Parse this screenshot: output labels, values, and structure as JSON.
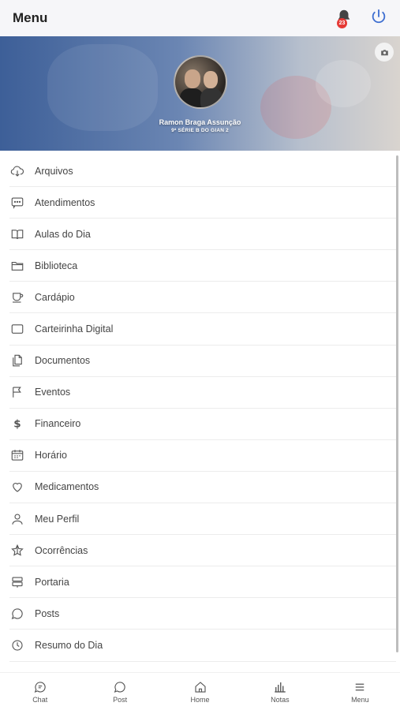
{
  "header": {
    "title": "Menu",
    "notification_count": "23",
    "bell_icon": "bell-icon",
    "power_icon": "power-icon"
  },
  "profile": {
    "name": "Ramon Braga Assunção",
    "class": "9ª SÉRIE B DO GIAN 2",
    "camera_icon": "camera-icon"
  },
  "menu": {
    "items": [
      {
        "label": "Arquivos",
        "icon": "cloud-download-icon"
      },
      {
        "label": "Atendimentos",
        "icon": "chat-box-icon"
      },
      {
        "label": "Aulas do Dia",
        "icon": "book-open-icon"
      },
      {
        "label": "Biblioteca",
        "icon": "folder-icon"
      },
      {
        "label": "Cardápio",
        "icon": "cup-icon"
      },
      {
        "label": "Carteirinha Digital",
        "icon": "card-icon"
      },
      {
        "label": "Documentos",
        "icon": "documents-icon"
      },
      {
        "label": "Eventos",
        "icon": "flag-icon"
      },
      {
        "label": "Financeiro",
        "icon": "dollar-icon"
      },
      {
        "label": "Horário",
        "icon": "calendar-icon"
      },
      {
        "label": "Medicamentos",
        "icon": "heart-icon"
      },
      {
        "label": "Meu Perfil",
        "icon": "user-icon"
      },
      {
        "label": "Ocorrências",
        "icon": "star-icon"
      },
      {
        "label": "Portaria",
        "icon": "signpost-icon"
      },
      {
        "label": "Posts",
        "icon": "speech-bubble-icon"
      },
      {
        "label": "Resumo do Dia",
        "icon": "clock-icon"
      },
      {
        "label": "",
        "icon": "partial-icon"
      }
    ]
  },
  "bottom_nav": {
    "items": [
      {
        "label": "Chat",
        "icon": "chat-icon"
      },
      {
        "label": "Post",
        "icon": "post-icon"
      },
      {
        "label": "Home",
        "icon": "home-icon"
      },
      {
        "label": "Notas",
        "icon": "bar-chart-icon"
      },
      {
        "label": "Menu",
        "icon": "hamburger-icon"
      }
    ]
  },
  "colors": {
    "badge": "#e53935",
    "topbar": "#f6f6f9",
    "icon": "#555555",
    "hero_start": "#3d5f98"
  }
}
